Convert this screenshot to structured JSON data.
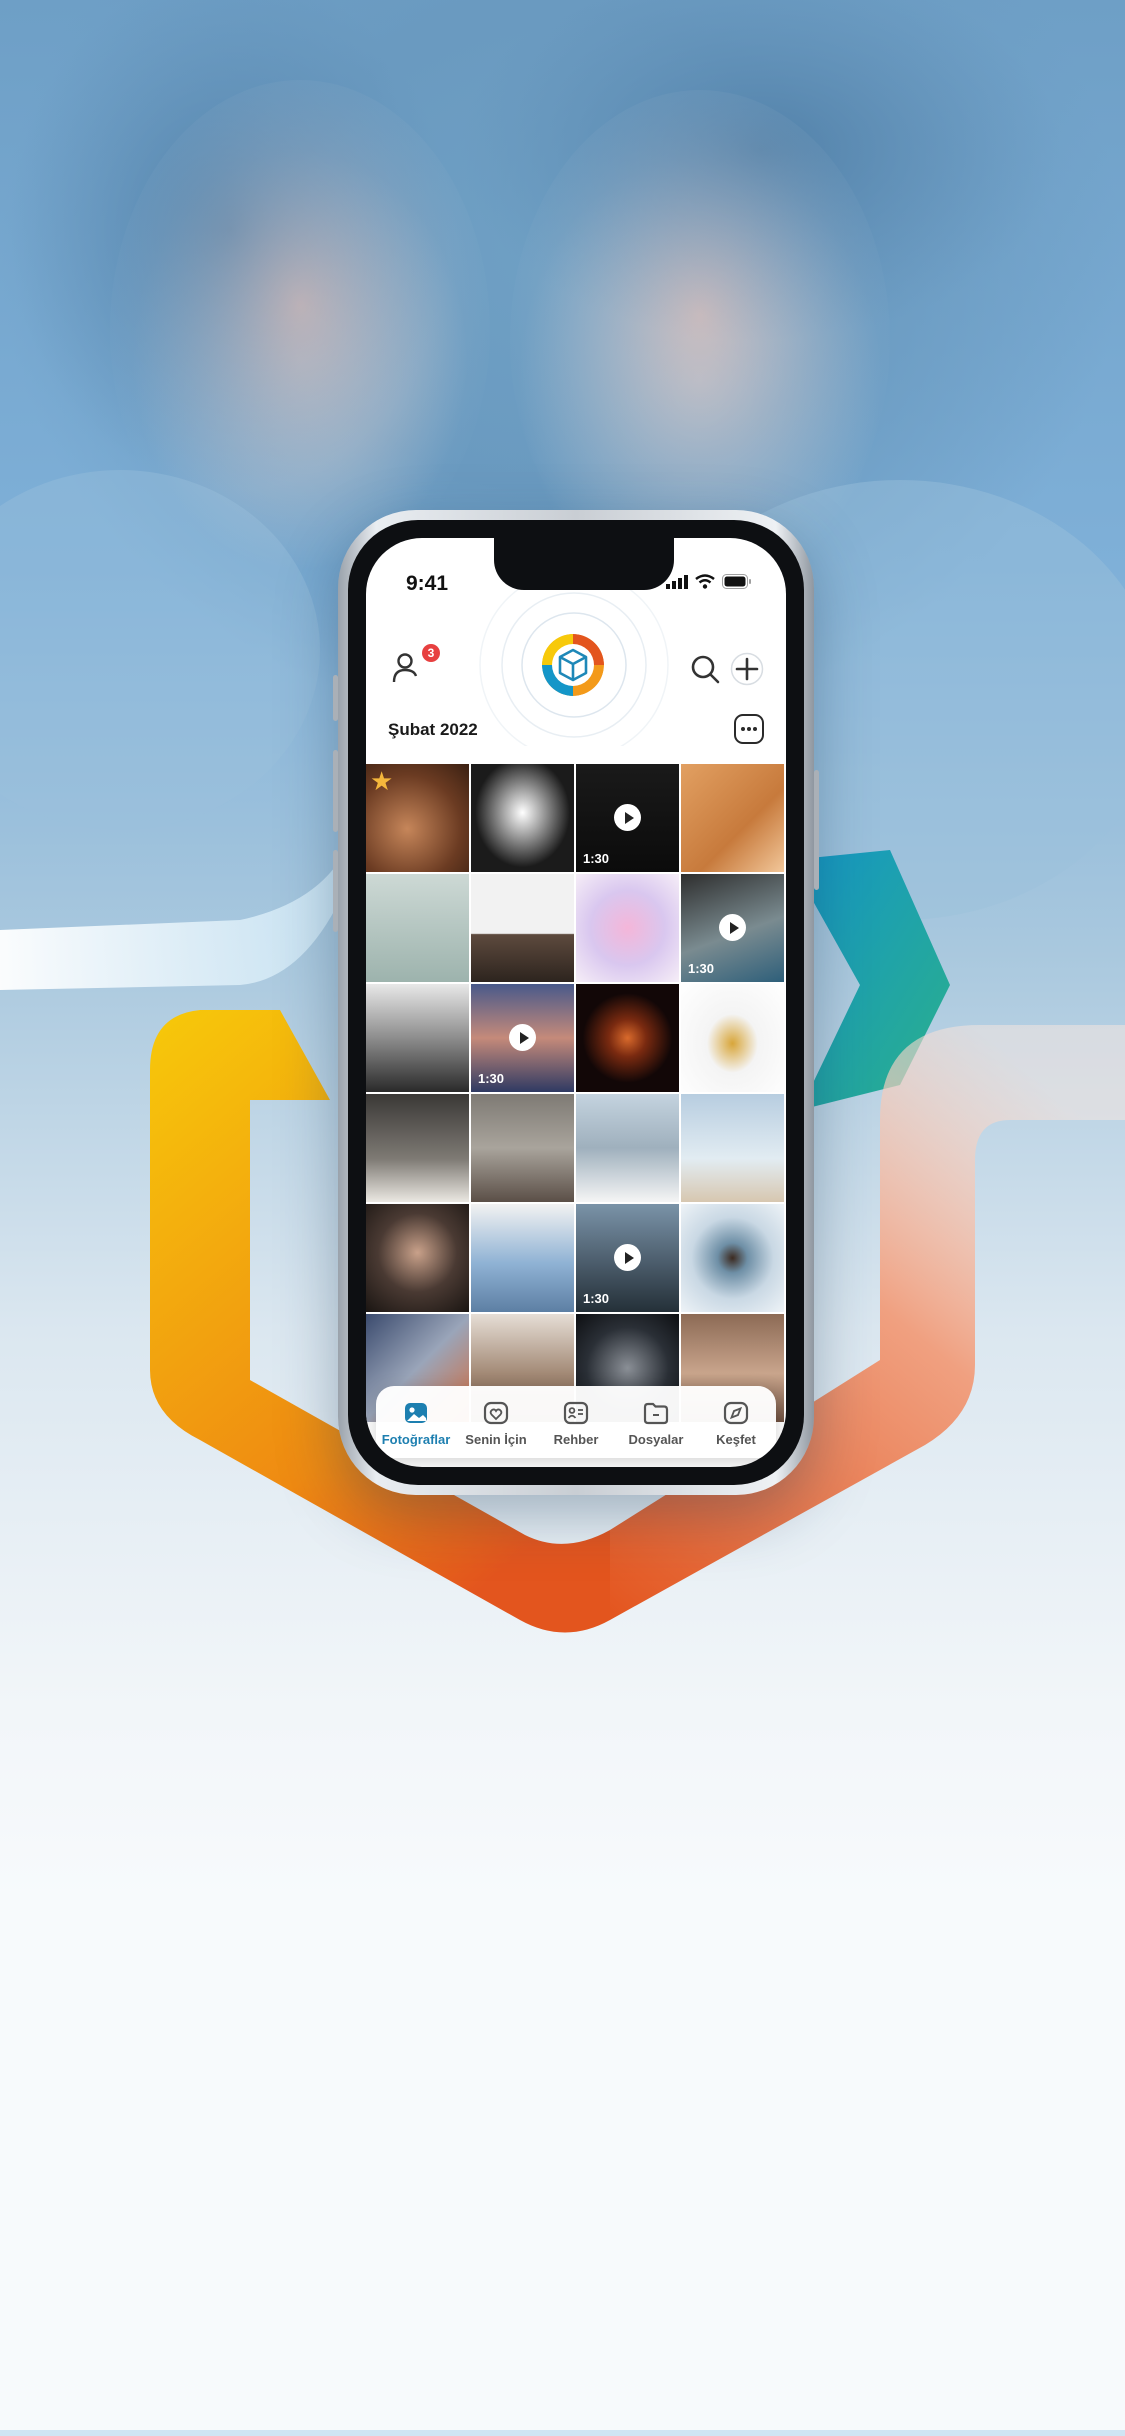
{
  "colors": {
    "accent": "#1d7fb0",
    "badge": "#e74040",
    "hex_yellow": "#f7c90a",
    "hex_orange": "#e3551e",
    "hex_blue": "#1496c8"
  },
  "status_bar": {
    "time": "9:41"
  },
  "header": {
    "notification_count": "3"
  },
  "section": {
    "title": "Şubat 2022"
  },
  "grid": {
    "items": [
      {
        "kind": "photo",
        "favorite": true
      },
      {
        "kind": "photo"
      },
      {
        "kind": "video",
        "duration": "1:30"
      },
      {
        "kind": "photo"
      },
      {
        "kind": "photo"
      },
      {
        "kind": "photo"
      },
      {
        "kind": "photo"
      },
      {
        "kind": "video",
        "duration": "1:30"
      },
      {
        "kind": "photo"
      },
      {
        "kind": "video",
        "duration": "1:30"
      },
      {
        "kind": "photo"
      },
      {
        "kind": "photo"
      },
      {
        "kind": "photo"
      },
      {
        "kind": "photo"
      },
      {
        "kind": "photo"
      },
      {
        "kind": "photo"
      },
      {
        "kind": "photo"
      },
      {
        "kind": "photo"
      },
      {
        "kind": "video",
        "duration": "1:30"
      },
      {
        "kind": "photo"
      },
      {
        "kind": "photo"
      },
      {
        "kind": "photo"
      },
      {
        "kind": "photo"
      },
      {
        "kind": "photo"
      }
    ]
  },
  "tabs": [
    {
      "label": "Fotoğraflar",
      "icon": "photos-icon",
      "active": true
    },
    {
      "label": "Senin İçin",
      "icon": "heart-icon",
      "active": false
    },
    {
      "label": "Rehber",
      "icon": "contacts-icon",
      "active": false
    },
    {
      "label": "Dosyalar",
      "icon": "folder-icon",
      "active": false
    },
    {
      "label": "Keşfet",
      "icon": "compass-icon",
      "active": false
    }
  ]
}
